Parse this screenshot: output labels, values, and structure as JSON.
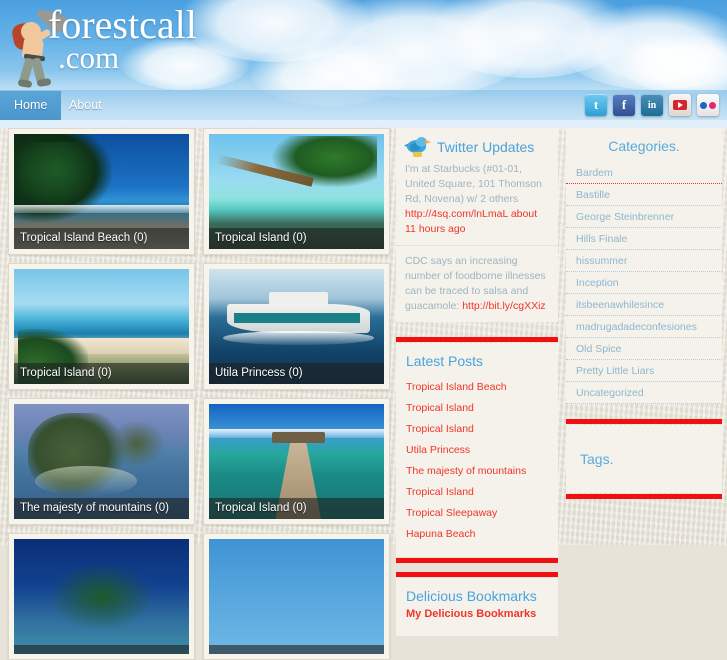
{
  "site": {
    "logo_name": "forestcall",
    "logo_tld": ".com",
    "mascot_icon": "man-with-megaphone-icon"
  },
  "nav": {
    "items": [
      {
        "label": "Home",
        "active": true
      },
      {
        "label": "About",
        "active": false
      }
    ]
  },
  "social": {
    "items": [
      {
        "name": "twitter-icon",
        "glyph": "t"
      },
      {
        "name": "facebook-icon",
        "glyph": "f"
      },
      {
        "name": "linkedin-icon",
        "glyph": "in"
      },
      {
        "name": "youtube-icon",
        "glyph": ""
      },
      {
        "name": "flickr-icon",
        "glyph": ""
      }
    ]
  },
  "gallery": {
    "items": [
      {
        "caption": "Tropical Island Beach (0)",
        "scene": "beach-palms"
      },
      {
        "caption": "Tropical Island (0)",
        "scene": "leaning-palm"
      },
      {
        "caption": "Tropical Island (0)",
        "scene": "umbrella-beach"
      },
      {
        "caption": "Utila Princess (0)",
        "scene": "ferry-boat"
      },
      {
        "caption": "The majesty of mountains (0)",
        "scene": "island-rock"
      },
      {
        "caption": "Tropical Island (0)",
        "scene": "wooden-pier"
      },
      {
        "caption": "",
        "scene": "dark-blue"
      },
      {
        "caption": "",
        "scene": "light-blue"
      }
    ]
  },
  "twitter": {
    "title": "Twitter Updates",
    "icon": "twitter-bird-icon",
    "tweets": [
      {
        "text_before": "I'm at Starbucks (#01-01, United Square, 101 Thomson Rd, Novena) w/ 2 others ",
        "link": "http://4sq.com/lnLmaL",
        "text_after": " about 11 hours ago"
      },
      {
        "text_before": "CDC says an increasing number of foodborne illnesses can be traced to salsa and guacamole: ",
        "link": "http://bit.ly/cgXXiz",
        "text_after": ""
      }
    ]
  },
  "latest_posts": {
    "title": "Latest Posts",
    "items": [
      "Tropical Island Beach",
      "Tropical Island",
      "Tropical Island",
      "Utila Princess",
      "The majesty of mountains",
      "Tropical Island",
      "Tropical Sleepaway",
      "Hapuna Beach"
    ]
  },
  "delicious": {
    "title": "Delicious Bookmarks",
    "subtitle": "My Delicious Bookmarks"
  },
  "categories": {
    "title": "Categories.",
    "items": [
      {
        "label": "Bardem",
        "highlighted": true
      },
      {
        "label": "Bastille",
        "highlighted": false
      },
      {
        "label": "George Steinbrenner",
        "highlighted": false
      },
      {
        "label": "Hills Finale",
        "highlighted": false
      },
      {
        "label": "hissummer",
        "highlighted": false
      },
      {
        "label": "Inception",
        "highlighted": false
      },
      {
        "label": "itsbeenawhilesince",
        "highlighted": false
      },
      {
        "label": "madrugadadeconfesiones",
        "highlighted": false
      },
      {
        "label": "Old Spice",
        "highlighted": false
      },
      {
        "label": "Pretty Little Liars",
        "highlighted": false
      },
      {
        "label": "Uncategorized",
        "highlighted": false
      }
    ]
  },
  "tags": {
    "title": "Tags."
  },
  "colors": {
    "accent_red": "#f10f0f",
    "link_red": "#f1352a",
    "heading_blue": "#4aa3dd",
    "nav_active": "#4b97cd"
  }
}
